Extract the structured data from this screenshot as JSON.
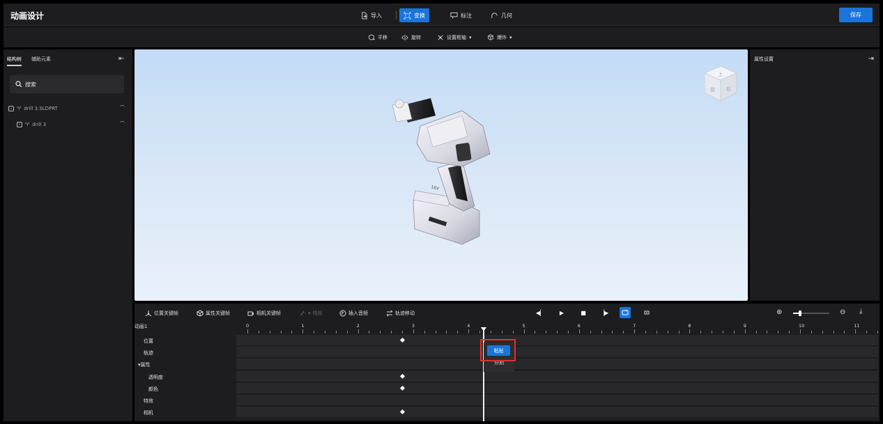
{
  "app": {
    "title": "动画设计",
    "save_label": "保存"
  },
  "toolbar": {
    "import_label": "导入",
    "transform_label": "变换",
    "annotate_label": "标注",
    "geometry_label": "几何"
  },
  "subtoolbar": {
    "translate_label": "平移",
    "rotate_label": "旋转",
    "pivot_label": "设置枢轴",
    "explode_label": "爆炸"
  },
  "left_panel": {
    "tabs": [
      {
        "label": "结构树"
      },
      {
        "label": "辅助元素"
      }
    ],
    "search_placeholder": "搜索",
    "tree": [
      {
        "label": "drill 3.SLDPRT",
        "expanded": true
      },
      {
        "label": "drill 3",
        "expanded": false
      }
    ]
  },
  "right_panel": {
    "title": "属性设置"
  },
  "viewcube": {
    "faces": [
      "上",
      "前",
      "右"
    ]
  },
  "model": {
    "battery_marking": "18V"
  },
  "timeline": {
    "buttons": {
      "position_keyframe": "位置关键帧",
      "property_keyframe": "属性关键帧",
      "camera_keyframe": "相机关键帧",
      "effects": "特效",
      "insert_audio": "插入音频",
      "track_move": "轨迹移动"
    },
    "animation_name": "动画1",
    "ruler": [
      "0",
      "1",
      "2",
      "3",
      "4",
      "5",
      "6",
      "7",
      "8",
      "9",
      "10",
      "11"
    ],
    "playhead_time": 4.2,
    "tracks": [
      {
        "label": "位置",
        "keyframes": [
          2.8
        ]
      },
      {
        "label": "轨迹",
        "keyframes": []
      },
      {
        "label": "属性",
        "keyframes": []
      },
      {
        "label": "透明度",
        "keyframes": [
          2.8
        ]
      },
      {
        "label": "颜色",
        "keyframes": [
          2.8
        ]
      },
      {
        "label": "特效",
        "keyframes": []
      },
      {
        "label": "相机",
        "keyframes": [
          2.8
        ]
      }
    ],
    "context_menu": {
      "paste": "粘贴",
      "split": "分割"
    }
  }
}
